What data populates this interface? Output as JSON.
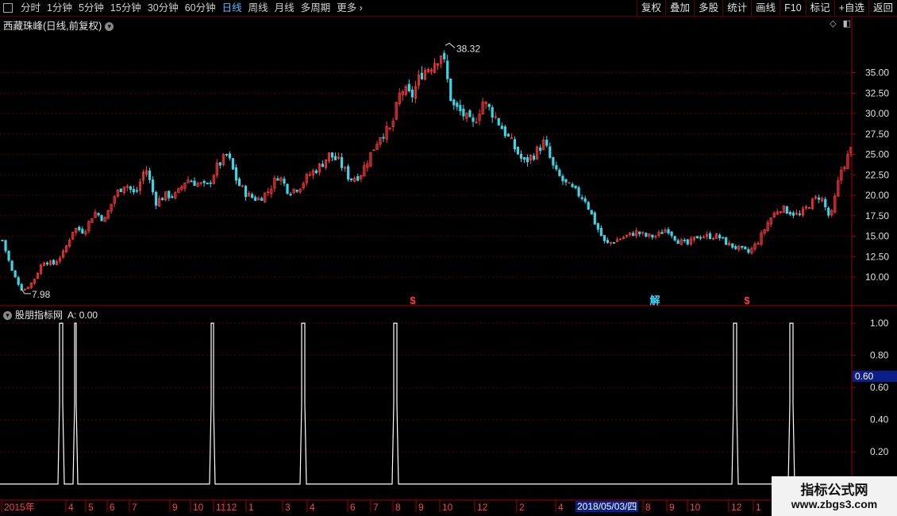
{
  "toolbar": {
    "periods": [
      "分时",
      "1分钟",
      "5分钟",
      "15分钟",
      "30分钟",
      "60分钟",
      "日线",
      "周线",
      "月线",
      "多周期",
      "更多"
    ],
    "active_period": "日线",
    "right_buttons": [
      "复权",
      "叠加",
      "多股",
      "统计",
      "画线",
      "F10",
      "标记",
      "+自选",
      "返回"
    ]
  },
  "main_panel": {
    "title": "西藏珠峰(日线,前复权)",
    "high_label": "38.32",
    "low_label": "7.98",
    "markers": [
      "$",
      "解",
      "$"
    ]
  },
  "indicator_panel": {
    "name": "股朋指标网",
    "value": "A: 0.00",
    "current_badge": "0.60"
  },
  "date_badge": "2018/05/03/四",
  "watermark": {
    "line1": "指标公式网",
    "line2": "www.zbgs3.com"
  },
  "colors": {
    "up": "#ff3a3a",
    "down": "#3ad6e6",
    "axis": "#a00000",
    "grid": "#5a0000",
    "signal": "#ffffff",
    "active_tab": "#58b4ff"
  },
  "chart_data": [
    {
      "type": "candlestick",
      "title": "西藏珠峰(日线,前复权)",
      "y_ticks": [
        10.0,
        12.5,
        15.0,
        17.5,
        20.0,
        22.5,
        25.0,
        27.5,
        30.0,
        32.5,
        35.0
      ],
      "ylim": [
        7.0,
        40.0
      ],
      "x_ticks": [
        "2015年",
        "4",
        "5",
        "6",
        "7",
        "9",
        "10",
        "11",
        "12",
        "1",
        "3",
        "4",
        "6",
        "7",
        "8",
        "9",
        "10",
        "12",
        "2",
        "4",
        "8",
        "9",
        "10",
        "12",
        "1"
      ],
      "close_series": [
        14.5,
        10.5,
        8.3,
        9.5,
        12.0,
        11.6,
        13.0,
        16.0,
        15.6,
        18.0,
        17.0,
        20.0,
        21.5,
        20.0,
        23.5,
        19.2,
        20.0,
        20.0,
        22.0,
        21.5,
        21.0,
        23.5,
        25.0,
        21.5,
        20.0,
        19.5,
        20.5,
        22.5,
        20.5,
        21.0,
        22.5,
        23.5,
        25.0,
        24.0,
        22.0,
        22.5,
        25.0,
        27.5,
        28.0,
        33.0,
        32.0,
        35.0,
        36.0,
        37.5,
        31.0,
        30.0,
        28.5,
        31.5,
        30.0,
        28.0,
        26.0,
        24.0,
        25.0,
        26.5,
        23.0,
        21.5,
        20.5,
        19.5,
        16.5,
        14.0,
        14.5,
        15.0,
        15.5,
        15.0,
        15.0,
        16.0,
        14.5,
        14.0,
        15.0,
        15.0,
        15.0,
        14.0,
        13.5,
        13.0,
        14.5,
        17.0,
        18.5,
        18.0,
        17.5,
        19.0,
        20.0,
        17.0,
        23.0,
        25.5
      ]
    },
    {
      "type": "line",
      "name": "A",
      "y_ticks": [
        0.2,
        0.4,
        0.6,
        0.8,
        1.0
      ],
      "ylim": [
        -0.09,
        1.06
      ],
      "x": [
        0,
        73,
        79,
        82,
        92,
        98,
        264,
        272,
        378,
        387,
        494,
        503,
        922,
        931,
        993,
        1002,
        1074
      ],
      "pulse_width": [
        6,
        3,
        6,
        6,
        6,
        6,
        6,
        6
      ],
      "values_note_pulses": [
        1,
        1,
        1,
        1,
        1,
        1,
        1,
        1
      ],
      "baseline": 0
    }
  ]
}
